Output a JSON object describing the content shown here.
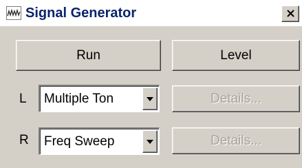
{
  "window": {
    "title": "Signal Generator",
    "icon": "waveform-icon",
    "close_icon": "close-icon"
  },
  "controls": {
    "run_label": "Run",
    "level_label": "Level"
  },
  "channels": [
    {
      "label": "L",
      "selected": "Multiple Ton",
      "details_label": "Details..."
    },
    {
      "label": "R",
      "selected": "Freq Sweep",
      "details_label": "Details..."
    }
  ],
  "colors": {
    "title_text": "#0a246a",
    "face": "#d4d0c8",
    "disabled_text": "#a8a49c"
  }
}
